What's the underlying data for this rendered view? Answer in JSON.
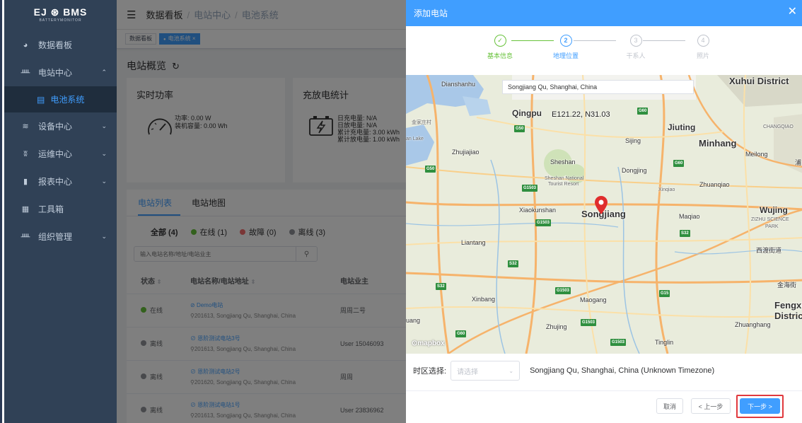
{
  "logo": {
    "text": "EJ ⊛ BMS",
    "sub": "BATTERYMONITOR"
  },
  "sidebar": {
    "items": [
      {
        "label": "数据看板",
        "icon": "dashboard-icon"
      },
      {
        "label": "电站中心",
        "icon": "station-icon"
      },
      {
        "label": "电池系统",
        "icon": "battery-icon",
        "sub": true
      },
      {
        "label": "设备中心",
        "icon": "device-icon"
      },
      {
        "label": "运维中心",
        "icon": "maintenance-icon"
      },
      {
        "label": "报表中心",
        "icon": "report-icon"
      },
      {
        "label": "工具箱",
        "icon": "toolbox-icon"
      },
      {
        "label": "组织管理",
        "icon": "org-icon"
      }
    ]
  },
  "breadcrumb": {
    "a": "数据看板",
    "b": "电站中心",
    "c": "电池系统"
  },
  "tags": {
    "a": "数据看板",
    "b": "电池系统"
  },
  "page": {
    "title": "电站概览"
  },
  "cards": {
    "power": {
      "title": "实时功率",
      "l1": "功率: 0.00 W",
      "l2": "装机容量: 0.00 Wh"
    },
    "charge": {
      "title": "充放电统计",
      "l1": "日充电量: N/A",
      "l2": "日放电量: N/A",
      "l3": "累计充电量: 3.00 kWh",
      "l4": "累计放电量: 1.00 kWh"
    }
  },
  "tabs": {
    "list": "电站列表",
    "map": "电站地图"
  },
  "filters": {
    "all": "全部 (4)",
    "online": "在线 (1)",
    "fault": "故障 (0)",
    "offline": "离线 (3)"
  },
  "search": {
    "placeholder": "输入电站名称/地址/电站业主"
  },
  "table": {
    "h1": "状态",
    "h2": "电站名称/电站地址",
    "h3": "电站业主",
    "rows": [
      {
        "status": "在线",
        "name": "Demo电站",
        "addr": "201613, Songjiang Qu, Shanghai, China",
        "owner": "周周二号"
      },
      {
        "status": "离线",
        "name": "恩阶测试电站3号",
        "addr": "201613, Songjiang Qu, Shanghai, China",
        "owner": "User 15046093"
      },
      {
        "status": "离线",
        "name": "恩阶测试电站2号",
        "addr": "201620, Songjiang Qu, Shanghai, China",
        "owner": "周周"
      },
      {
        "status": "离线",
        "name": "恩阶测试电站1号",
        "addr": "201613, Songjiang Qu, Shanghai, China",
        "owner": "User 23836962"
      }
    ]
  },
  "drawer": {
    "title": "添加电站",
    "steps": [
      {
        "num": "✓",
        "label": "基本信息"
      },
      {
        "num": "2",
        "label": "地理位置"
      },
      {
        "num": "3",
        "label": "干系人"
      },
      {
        "num": "4",
        "label": "照片"
      }
    ],
    "map_search": "Songjiang Qu, Shanghai, China",
    "coord": "E121.22,  N31.03",
    "map_labels": {
      "dianshanhu": "Dianshanhu",
      "xuhui": "Xuhui District",
      "qingpu": "Qingpu",
      "jinjia": "金家庄村",
      "jiuting": "Jiuting",
      "changqiao": "CHANGQIAO",
      "sijing": "Sijing",
      "minhang": "Minhang",
      "meilong": "Meilong",
      "lake": "an Lake",
      "zhujiajiao": "Zhujiajiao",
      "sheshan": "Sheshan",
      "dongjing": "Dongjing",
      "shnational": "Sheshan National",
      "tourist": "Tourist Resort",
      "zhuanqiao": "Zhuanqiao",
      "xinqiao": "Xinqiao",
      "xiaokun": "Xiaokunshan",
      "songjiang": "Songjiang",
      "maqiao": "Maqiao",
      "wujing": "Wujing",
      "zizhu": "ZIZHU SCIENCE",
      "park": "PARK",
      "liantang": "Liantang",
      "xidu": "西渡街道",
      "jinhai": "金海街",
      "xinbang": "Xinbang",
      "maogang": "Maogang",
      "fengxian": "Fengxia",
      "district": "Distric",
      "uang": "uang",
      "zhujing": "Zhujing",
      "zhuanghang": "Zhuanghang",
      "tinglin": "Tinglin",
      "pu": "浦",
      "mapbox": "mapbox"
    },
    "shields": {
      "g50a": "G50",
      "g50b": "G50",
      "g1503a": "G1503",
      "g1503b": "G1503",
      "g1503c": "G1503",
      "g1503d": "G1503",
      "g1503e": "G1503",
      "s32a": "S32",
      "s32b": "S32",
      "s32c": "S32",
      "g60a": "G60",
      "g60b": "G60",
      "g15": "G15",
      "g60c": "G60"
    },
    "tz_label": "时区选择:",
    "tz_placeholder": "请选择",
    "tz_value": "Songjiang Qu, Shanghai, China (Unknown Timezone)",
    "cancel": "取消",
    "prev": "< 上一步",
    "next": "下一步 >"
  },
  "colors": {
    "primary": "#409eff",
    "success": "#67c23a",
    "danger": "#f56c6c",
    "sidebar": "#304156",
    "highlight": "#e0393e"
  }
}
